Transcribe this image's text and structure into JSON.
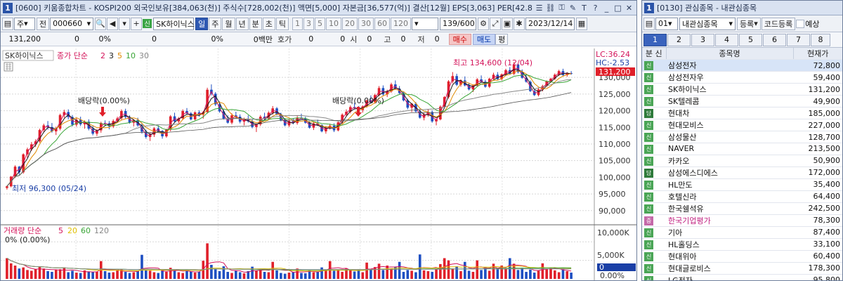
{
  "chart_window": {
    "num": "1",
    "title": "[0600] 키움종합차트 - KOSPI200 외국인보유[384,063(천)] 주식수[728,002(천)] 액면[5,000] 자본금[36,577(억)] 결산[12월] EPS[3,063] PER[42.8",
    "toolbar": {
      "period_type": "주",
      "prev_label": "전",
      "stock_code": "000660",
      "stock_name": "SK하이닉스",
      "periods": [
        "일",
        "주",
        "월",
        "년",
        "분",
        "초",
        "틱"
      ],
      "active_period": "일",
      "intervals": [
        "1",
        "3",
        "5",
        "10",
        "20",
        "30",
        "60",
        "120"
      ],
      "count": "139/600",
      "date": "2023/12/14"
    },
    "quote": {
      "price": "131,200",
      "change": "0",
      "change_pct": "0%",
      "volume": "0",
      "volume_pct": "0%",
      "amount": "0백만",
      "hoga_label": "호가",
      "hoga_val": "0",
      "v1": "0",
      "si_label": "시",
      "si_val": "0",
      "go_label": "고",
      "go_val": "0",
      "jeo_label": "저",
      "jeo_val": "0",
      "buy": "매수",
      "sell": "매도",
      "pyeong": "평"
    },
    "price_panel": {
      "stock_tag": "SK하이닉스",
      "legend_prefix": "종가 단순",
      "ma": [
        {
          "period": "2",
          "color": "#d4145a"
        },
        {
          "period": "3",
          "color": "#1a1a1a"
        },
        {
          "period": "5",
          "color": "#e08a00"
        },
        {
          "period": "10",
          "color": "#3aa537"
        },
        {
          "period": "30",
          "color": "#888888"
        }
      ],
      "lc_label": "LC:36.24",
      "hc_label": "HC:-2.53",
      "current_price_tag": "131,200",
      "high_annotation": "최고 134,600 (12/04)",
      "low_annotation": "최저 96,300 (05/24)",
      "dividend_annotation": "배당락(0.00%)",
      "y_ticks": [
        "130,000",
        "125,000",
        "120,000",
        "115,000",
        "110,000",
        "105,000",
        "100,000",
        "95,000",
        "90,000"
      ]
    },
    "volume_panel": {
      "legend_prefix": "거래량 단순",
      "ma": [
        {
          "period": "5",
          "color": "#d4145a"
        },
        {
          "period": "20",
          "color": "#e0c000"
        },
        {
          "period": "60",
          "color": "#3aa537"
        },
        {
          "period": "120",
          "color": "#888888"
        }
      ],
      "pct_label": "0% (0.00%)",
      "y_ticks": [
        "10,000K",
        "5,000K"
      ],
      "current_tag": "0",
      "zero_label": "0.00%"
    }
  },
  "watch_window": {
    "num": "1",
    "title": "[0130] 관심종목 - 내관심종목",
    "group_num": "01",
    "group_name": "내관심종목",
    "register_btn": "등록",
    "code_register_btn": "코드등록",
    "preview_label": "예상",
    "tabs": [
      "1",
      "2",
      "3",
      "4",
      "5",
      "6",
      "7",
      "8"
    ],
    "active_tab": "1",
    "headers": {
      "category": "분 신",
      "name": "종목명",
      "price": "현재가"
    },
    "rows": [
      {
        "badge": "신",
        "badge_style": "green",
        "name": "삼성전자",
        "price": "72,800",
        "name_color": "#111"
      },
      {
        "badge": "신",
        "badge_style": "green",
        "name": "삼성전자우",
        "price": "59,400",
        "name_color": "#111"
      },
      {
        "badge": "신",
        "badge_style": "green",
        "name": "SK하이닉스",
        "price": "131,200",
        "name_color": "#111"
      },
      {
        "badge": "신",
        "badge_style": "green",
        "name": "SK텔레콤",
        "price": "49,900",
        "name_color": "#111"
      },
      {
        "badge": "담",
        "badge_style": "dark",
        "name": "현대차",
        "price": "185,000",
        "name_color": "#111"
      },
      {
        "badge": "신",
        "badge_style": "green",
        "name": "현대모비스",
        "price": "227,000",
        "name_color": "#111"
      },
      {
        "badge": "신",
        "badge_style": "green",
        "name": "삼성물산",
        "price": "128,700",
        "name_color": "#111"
      },
      {
        "badge": "신",
        "badge_style": "green",
        "name": "NAVER",
        "price": "213,500",
        "name_color": "#111"
      },
      {
        "badge": "신",
        "badge_style": "green",
        "name": "카카오",
        "price": "50,900",
        "name_color": "#111"
      },
      {
        "badge": "담",
        "badge_style": "dark",
        "name": "삼성에스디에스",
        "price": "172,000",
        "name_color": "#111"
      },
      {
        "badge": "신",
        "badge_style": "green",
        "name": "HL만도",
        "price": "35,400",
        "name_color": "#111"
      },
      {
        "badge": "신",
        "badge_style": "green",
        "name": "호텔신라",
        "price": "64,400",
        "name_color": "#111"
      },
      {
        "badge": "신",
        "badge_style": "green",
        "name": "한국쉘석유",
        "price": "242,500",
        "name_color": "#111"
      },
      {
        "badge": "증",
        "badge_style": "pink",
        "name": "한국기업평가",
        "price": "78,300",
        "name_color": "#c02080"
      },
      {
        "badge": "신",
        "badge_style": "green",
        "name": "기아",
        "price": "87,400",
        "name_color": "#111"
      },
      {
        "badge": "신",
        "badge_style": "green",
        "name": "HL홀딩스",
        "price": "33,100",
        "name_color": "#111"
      },
      {
        "badge": "신",
        "badge_style": "green",
        "name": "현대위아",
        "price": "60,400",
        "name_color": "#111"
      },
      {
        "badge": "신",
        "badge_style": "green",
        "name": "현대글로비스",
        "price": "178,300",
        "name_color": "#111"
      },
      {
        "badge": "신",
        "badge_style": "green",
        "name": "LG전자",
        "price": "95,800",
        "name_color": "#111"
      }
    ]
  },
  "chart_data": {
    "type": "candlestick",
    "price_range": [
      87000,
      137000
    ],
    "volume_range": [
      0,
      11000
    ],
    "candles": [
      [
        96.8,
        97.5,
        96.3,
        97.3
      ],
      [
        97.3,
        100.4,
        97,
        100.2
      ],
      [
        100.2,
        103.6,
        99.8,
        103.2
      ],
      [
        103.2,
        103.4,
        100.8,
        101.5
      ],
      [
        101.5,
        107.2,
        101.1,
        106.9
      ],
      [
        106.9,
        108.9,
        105.8,
        108.4
      ],
      [
        108.4,
        110.6,
        107.9,
        109.9
      ],
      [
        109.9,
        111.4,
        109.1,
        110.8
      ],
      [
        110.8,
        114.6,
        110.4,
        114.2
      ],
      [
        114.2,
        116.1,
        113.5,
        115.6
      ],
      [
        115.6,
        116.9,
        114.3,
        115.1
      ],
      [
        115.1,
        116.3,
        113.4,
        113.8
      ],
      [
        113.8,
        115.2,
        112.7,
        114.6
      ],
      [
        114.6,
        119.1,
        114.1,
        118.7
      ],
      [
        118.7,
        120.3,
        117.9,
        119.6
      ],
      [
        119.6,
        120.4,
        117.4,
        118.1
      ],
      [
        118.1,
        118.7,
        115.3,
        115.8
      ],
      [
        115.8,
        117.8,
        115.2,
        117.3
      ],
      [
        117.3,
        118.2,
        115.4,
        115.9
      ],
      [
        115.9,
        117.1,
        114.6,
        116.7
      ],
      [
        116.7,
        117.4,
        114.1,
        114.6
      ],
      [
        114.6,
        115.4,
        112.6,
        113.1
      ],
      [
        113.1,
        114.5,
        112.4,
        114.1
      ],
      [
        114.1,
        116.7,
        113.4,
        116.3
      ],
      [
        116.3,
        117.1,
        115.6,
        116.2
      ],
      [
        116.2,
        116.9,
        114.4,
        115.3
      ],
      [
        115.3,
        117.4,
        114.8,
        116.9
      ],
      [
        116.9,
        118.2,
        116.3,
        117.7
      ],
      [
        117.7,
        120.4,
        117.2,
        119.9
      ],
      [
        119.9,
        120.6,
        117.6,
        118.1
      ],
      [
        118.1,
        118.6,
        116.1,
        116.4
      ],
      [
        116.4,
        117.5,
        115.3,
        117.2
      ],
      [
        117.2,
        117.9,
        115.2,
        115.6
      ],
      [
        115.6,
        116.2,
        113.1,
        113.7
      ],
      [
        113.7,
        114.3,
        111.6,
        112.1
      ],
      [
        112.1,
        113.4,
        110.9,
        112.8
      ],
      [
        112.8,
        115.1,
        112.1,
        114.7
      ],
      [
        114.7,
        115.6,
        113.6,
        113.9
      ],
      [
        113.9,
        114.2,
        111.6,
        112.3
      ],
      [
        112.3,
        114.6,
        111.9,
        114.3
      ],
      [
        114.3,
        118.7,
        113.8,
        118.3
      ],
      [
        118.3,
        119.4,
        116.5,
        116.8
      ],
      [
        116.8,
        118.1,
        116.2,
        117.7
      ],
      [
        117.7,
        120.4,
        117.2,
        119.9
      ],
      [
        119.9,
        120.8,
        118.8,
        119.2
      ],
      [
        119.2,
        119.6,
        117.1,
        117.4
      ],
      [
        117.4,
        119.8,
        117.1,
        119.5
      ],
      [
        119.5,
        120.1,
        118.2,
        118.8
      ],
      [
        118.8,
        119.9,
        117.6,
        119.6
      ],
      [
        119.6,
        126.9,
        119.1,
        126.3
      ],
      [
        126.3,
        127.9,
        124.6,
        125.1
      ],
      [
        125.1,
        125.6,
        121.4,
        121.9
      ],
      [
        121.9,
        122.8,
        119.4,
        119.8
      ],
      [
        119.8,
        120.3,
        117.3,
        117.6
      ],
      [
        117.6,
        118.6,
        116.1,
        116.4
      ],
      [
        116.4,
        119.2,
        115.9,
        118.6
      ],
      [
        118.6,
        119.7,
        117.8,
        118.2
      ],
      [
        118.2,
        118.9,
        116.2,
        116.7
      ],
      [
        116.7,
        117.9,
        115.6,
        117.4
      ],
      [
        117.4,
        118.6,
        116.4,
        116.8
      ],
      [
        116.8,
        117.4,
        114.7,
        115.1
      ],
      [
        115.1,
        116.2,
        113.6,
        115.9
      ],
      [
        115.9,
        118.7,
        115.4,
        118.2
      ],
      [
        118.2,
        119.4,
        117.1,
        117.6
      ],
      [
        117.6,
        119.8,
        117.2,
        119.4
      ],
      [
        119.4,
        121.4,
        118.8,
        120.7
      ],
      [
        120.7,
        121.1,
        118.6,
        118.9
      ],
      [
        118.9,
        119.4,
        116.8,
        117.2
      ],
      [
        117.2,
        117.8,
        115.3,
        115.6
      ],
      [
        115.6,
        117.4,
        115.1,
        116.9
      ],
      [
        116.9,
        117.6,
        115.9,
        116.3
      ],
      [
        116.3,
        118.4,
        115.8,
        117.9
      ],
      [
        117.9,
        119.1,
        117.2,
        117.6
      ],
      [
        117.6,
        118.2,
        116.1,
        116.4
      ],
      [
        116.4,
        116.9,
        114.6,
        114.9
      ],
      [
        114.9,
        116.6,
        114.2,
        116.2
      ],
      [
        116.2,
        117.3,
        115.4,
        115.7
      ],
      [
        115.7,
        115.9,
        113.5,
        113.8
      ],
      [
        113.8,
        115.4,
        113.1,
        114.9
      ],
      [
        114.9,
        116.1,
        114.3,
        115.5
      ],
      [
        115.5,
        116.2,
        113.6,
        114.1
      ],
      [
        114.1,
        116.8,
        113.8,
        116.5
      ],
      [
        116.5,
        119.2,
        116.1,
        118.8
      ],
      [
        118.8,
        120.4,
        118.4,
        119.7
      ],
      [
        119.7,
        121.6,
        119.2,
        121.1
      ],
      [
        121.1,
        122.3,
        120.4,
        120.8
      ],
      [
        120.8,
        121.4,
        119.6,
        120.2
      ],
      [
        120.2,
        121.6,
        119.4,
        121.3
      ],
      [
        121.3,
        123.4,
        120.9,
        123.1
      ],
      [
        123.1,
        124.6,
        122.2,
        122.6
      ],
      [
        122.6,
        125.1,
        122.1,
        124.7
      ],
      [
        124.7,
        127.4,
        124.3,
        126.8
      ],
      [
        126.8,
        127.6,
        124.4,
        124.9
      ],
      [
        124.9,
        126.3,
        124.1,
        125.8
      ],
      [
        125.8,
        128.4,
        125.4,
        127.9
      ],
      [
        127.9,
        129.1,
        126.3,
        126.6
      ],
      [
        126.6,
        127.4,
        124.9,
        125.3
      ],
      [
        125.3,
        125.8,
        122.8,
        123.1
      ],
      [
        123.1,
        123.6,
        120.4,
        120.9
      ],
      [
        120.9,
        122.3,
        119.6,
        122.1
      ],
      [
        122.1,
        122.6,
        119.4,
        119.8
      ],
      [
        119.8,
        120.6,
        117.6,
        117.9
      ],
      [
        117.9,
        119.3,
        117.1,
        118.8
      ],
      [
        118.8,
        120.4,
        118.2,
        119.6
      ],
      [
        119.6,
        120.1,
        116.4,
        116.8
      ],
      [
        116.8,
        117.7,
        115.6,
        117.4
      ],
      [
        117.4,
        121.6,
        117.1,
        121.2
      ],
      [
        121.2,
        124.4,
        120.8,
        124.1
      ],
      [
        124.1,
        129.2,
        123.6,
        128.8
      ],
      [
        128.8,
        131.6,
        128.2,
        130.4
      ],
      [
        130.4,
        131.1,
        127.4,
        127.8
      ],
      [
        127.8,
        129.4,
        127.2,
        129.1
      ],
      [
        129.1,
        130.3,
        127.3,
        127.6
      ],
      [
        127.6,
        128.4,
        126.1,
        126.4
      ],
      [
        126.4,
        127.9,
        125.6,
        127.6
      ],
      [
        127.6,
        129.8,
        127.2,
        129.4
      ],
      [
        129.4,
        130.6,
        128.4,
        128.7
      ],
      [
        128.7,
        129.3,
        126.9,
        127.2
      ],
      [
        127.2,
        129.9,
        126.8,
        129.6
      ],
      [
        129.6,
        131.4,
        129.1,
        130.8
      ],
      [
        130.8,
        131.6,
        129.2,
        129.5
      ],
      [
        129.5,
        131.2,
        129.1,
        130.9
      ],
      [
        130.9,
        132.6,
        130.4,
        132.2
      ],
      [
        132.2,
        133.1,
        130.8,
        131.1
      ],
      [
        131.1,
        134.6,
        130.7,
        133.9
      ],
      [
        133.9,
        134.1,
        131.2,
        131.6
      ],
      [
        131.6,
        132.4,
        129.6,
        129.9
      ],
      [
        129.9,
        131.1,
        128.4,
        128.7
      ],
      [
        128.7,
        129.1,
        125.6,
        125.9
      ],
      [
        125.9,
        126.6,
        124.4,
        124.7
      ],
      [
        124.7,
        126.9,
        124.3,
        126.4
      ],
      [
        126.4,
        127.8,
        125.8,
        127.4
      ],
      [
        127.4,
        129.1,
        127.1,
        128.8
      ],
      [
        128.8,
        129.9,
        128.4,
        129.6
      ],
      [
        129.6,
        131.2,
        129.2,
        130.8
      ],
      [
        130.8,
        132.3,
        130.4,
        131.9
      ],
      [
        131.9,
        132.6,
        130.4,
        130.7
      ],
      [
        130.7,
        131.6,
        130.2,
        131.3
      ],
      [
        131.3,
        131.9,
        130.8,
        131.2
      ]
    ],
    "volumes": [
      5.6,
      4.2,
      3.6,
      2.8,
      3.1,
      2.4,
      2.2,
      2.6,
      3.2,
      2.8,
      2.1,
      1.9,
      2.4,
      2.6,
      3.1,
      1.8,
      2.2,
      1.7,
      1.6,
      2.3,
      2.0,
      1.8,
      1.9,
      4.8,
      2.1,
      1.7,
      1.8,
      2.4,
      2.6,
      1.9,
      1.6,
      1.8,
      2.1,
      6.5,
      2.4,
      2.2,
      1.8,
      1.6,
      2.6,
      1.9,
      3.0,
      2.2,
      1.8,
      1.6,
      2.4,
      2.0,
      1.7,
      1.9,
      4.9,
      9.6,
      3.8,
      2.6,
      2.1,
      3.4,
      1.9,
      1.6,
      2.2,
      1.8,
      1.5,
      2.1,
      3.3,
      2.2,
      2.5,
      1.9,
      1.8,
      4.6,
      2.3,
      1.6,
      1.4,
      1.7,
      1.9,
      2.8,
      1.6,
      1.5,
      2.3,
      1.8,
      2.0,
      3.1,
      2.5,
      4.8,
      2.2,
      2.6,
      1.9,
      2.8,
      2.4,
      2.0,
      2.6,
      1.8,
      4.4,
      2.6,
      3.2,
      4.1,
      2.4,
      3.6,
      2.8,
      3.3,
      4.6,
      1.9,
      2.4,
      2.2,
      1.8,
      6.6,
      2.3,
      2.1,
      1.9,
      2.6,
      4.0,
      5.6,
      5.0,
      2.8,
      3.4,
      2.1,
      4.6,
      2.2,
      1.9,
      5.0,
      2.4,
      3.1,
      2.2,
      4.1,
      2.6,
      3.6,
      2.8,
      5.6,
      4.1,
      2.4,
      3.0,
      1.9,
      2.5,
      1.7,
      2.2,
      4.2,
      2.6,
      2.9,
      2.3,
      1.8,
      2.6,
      2.1,
      1.7
    ]
  }
}
